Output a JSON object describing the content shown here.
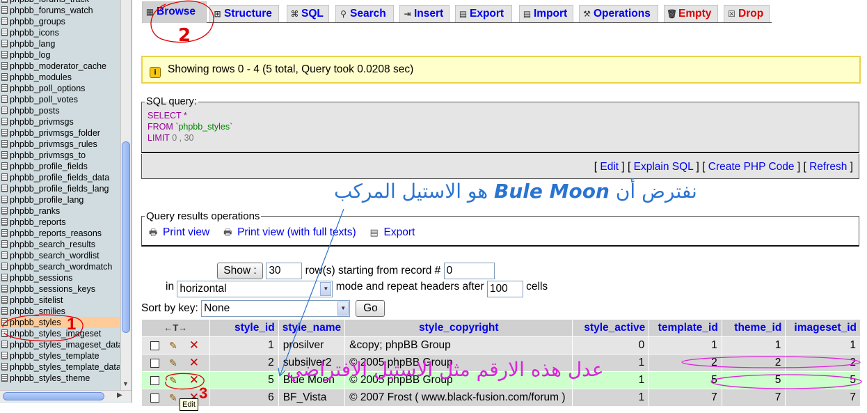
{
  "sidebar": {
    "tables": [
      "phpbb_forums_track",
      "phpbb_forums_watch",
      "phpbb_groups",
      "phpbb_icons",
      "phpbb_lang",
      "phpbb_log",
      "phpbb_moderator_cache",
      "phpbb_modules",
      "phpbb_poll_options",
      "phpbb_poll_votes",
      "phpbb_posts",
      "phpbb_privmsgs",
      "phpbb_privmsgs_folder",
      "phpbb_privmsgs_rules",
      "phpbb_privmsgs_to",
      "phpbb_profile_fields",
      "phpbb_profile_fields_data",
      "phpbb_profile_fields_lang",
      "phpbb_profile_lang",
      "phpbb_ranks",
      "phpbb_reports",
      "phpbb_reports_reasons",
      "phpbb_search_results",
      "phpbb_search_wordlist",
      "phpbb_search_wordmatch",
      "phpbb_sessions",
      "phpbb_sessions_keys",
      "phpbb_sitelist",
      "phpbb_smilies",
      "phpbb_styles",
      "phpbb_styles_imageset",
      "phpbb_styles_imageset_data",
      "phpbb_styles_template",
      "phpbb_styles_template_data",
      "phpbb_styles_theme"
    ],
    "active_index": 29
  },
  "tabs": [
    {
      "label": "Browse",
      "icon": "browse-icon",
      "glyph": "▦"
    },
    {
      "label": "Structure",
      "icon": "structure-icon",
      "glyph": "⊞"
    },
    {
      "label": "SQL",
      "icon": "sql-icon",
      "glyph": "⌘"
    },
    {
      "label": "Search",
      "icon": "search-icon",
      "glyph": "⚲"
    },
    {
      "label": "Insert",
      "icon": "insert-icon",
      "glyph": "⇥"
    },
    {
      "label": "Export",
      "icon": "export-icon",
      "glyph": "▤"
    },
    {
      "label": "Import",
      "icon": "import-icon",
      "glyph": "▤"
    },
    {
      "label": "Operations",
      "icon": "operations-icon",
      "glyph": "⚒"
    },
    {
      "label": "Empty",
      "icon": "empty-icon",
      "glyph": "🗑"
    },
    {
      "label": "Drop",
      "icon": "drop-icon",
      "glyph": "☒"
    }
  ],
  "notice": {
    "text": "Showing rows 0 - 4 (5 total, Query took 0.0208 sec)"
  },
  "sql_query": {
    "legend": "SQL query:",
    "line1_kw": "SELECT",
    "line1_rest": " *",
    "line2_kw": "FROM",
    "line2_str": " `phpbb_styles`",
    "line3_kw": "LIMIT",
    "line3_num": " 0 , 30",
    "links": {
      "edit": "Edit",
      "explain": "Explain SQL",
      "php": "Create PHP Code",
      "refresh": "Refresh"
    }
  },
  "results_ops": {
    "legend": "Query results operations",
    "print": "Print view",
    "print_full": "Print view (with full texts)",
    "export": "Export"
  },
  "nav": {
    "show_button": "Show :",
    "rows_value": "30",
    "rows_label": "row(s) starting from record #",
    "start_value": "0",
    "in_label": "in",
    "mode_value": "horizontal",
    "mode_label": "mode and repeat headers after",
    "headers_value": "100",
    "cells_label": "cells",
    "sort_label": "Sort by key:",
    "sort_value": "None",
    "go_button": "Go"
  },
  "table": {
    "arrows": "←T→",
    "columns": [
      "style_id",
      "style_name",
      "style_copyright",
      "style_active",
      "template_id",
      "theme_id",
      "imageset_id"
    ],
    "rows": [
      [
        "1",
        "prosilver",
        "&copy; phpBB Group",
        "0",
        "1",
        "1",
        "1"
      ],
      [
        "2",
        "subsilver2",
        "© 2005 phpBB Group",
        "1",
        "2",
        "2",
        "2"
      ],
      [
        "5",
        "Blue Moon",
        "© 2005 phpBB Group",
        "1",
        "5",
        "5",
        "5"
      ],
      [
        "6",
        "BF_Vista",
        "© 2007 Frost ( www.black-fusion.com/forum )",
        "1",
        "7",
        "7",
        "7"
      ]
    ],
    "highlight_row": 2
  },
  "tooltip": "Edit",
  "annotations": {
    "arabic_top_pre": "نفترض أن",
    "arabic_top_brand": "Bule Moon",
    "arabic_top_post": "هو الاستيل المركب",
    "arabic_row": "عدل هذه الارقم مثل الاستيل الافتراضي",
    "mark1": "1",
    "mark2": "2",
    "mark3": "3"
  },
  "colors": {
    "link": "#0000ee",
    "danger": "#dd0000",
    "annotation_red": "#e00000",
    "annotation_blue": "#2a74d1",
    "annotation_magenta": "#dd22dd"
  }
}
